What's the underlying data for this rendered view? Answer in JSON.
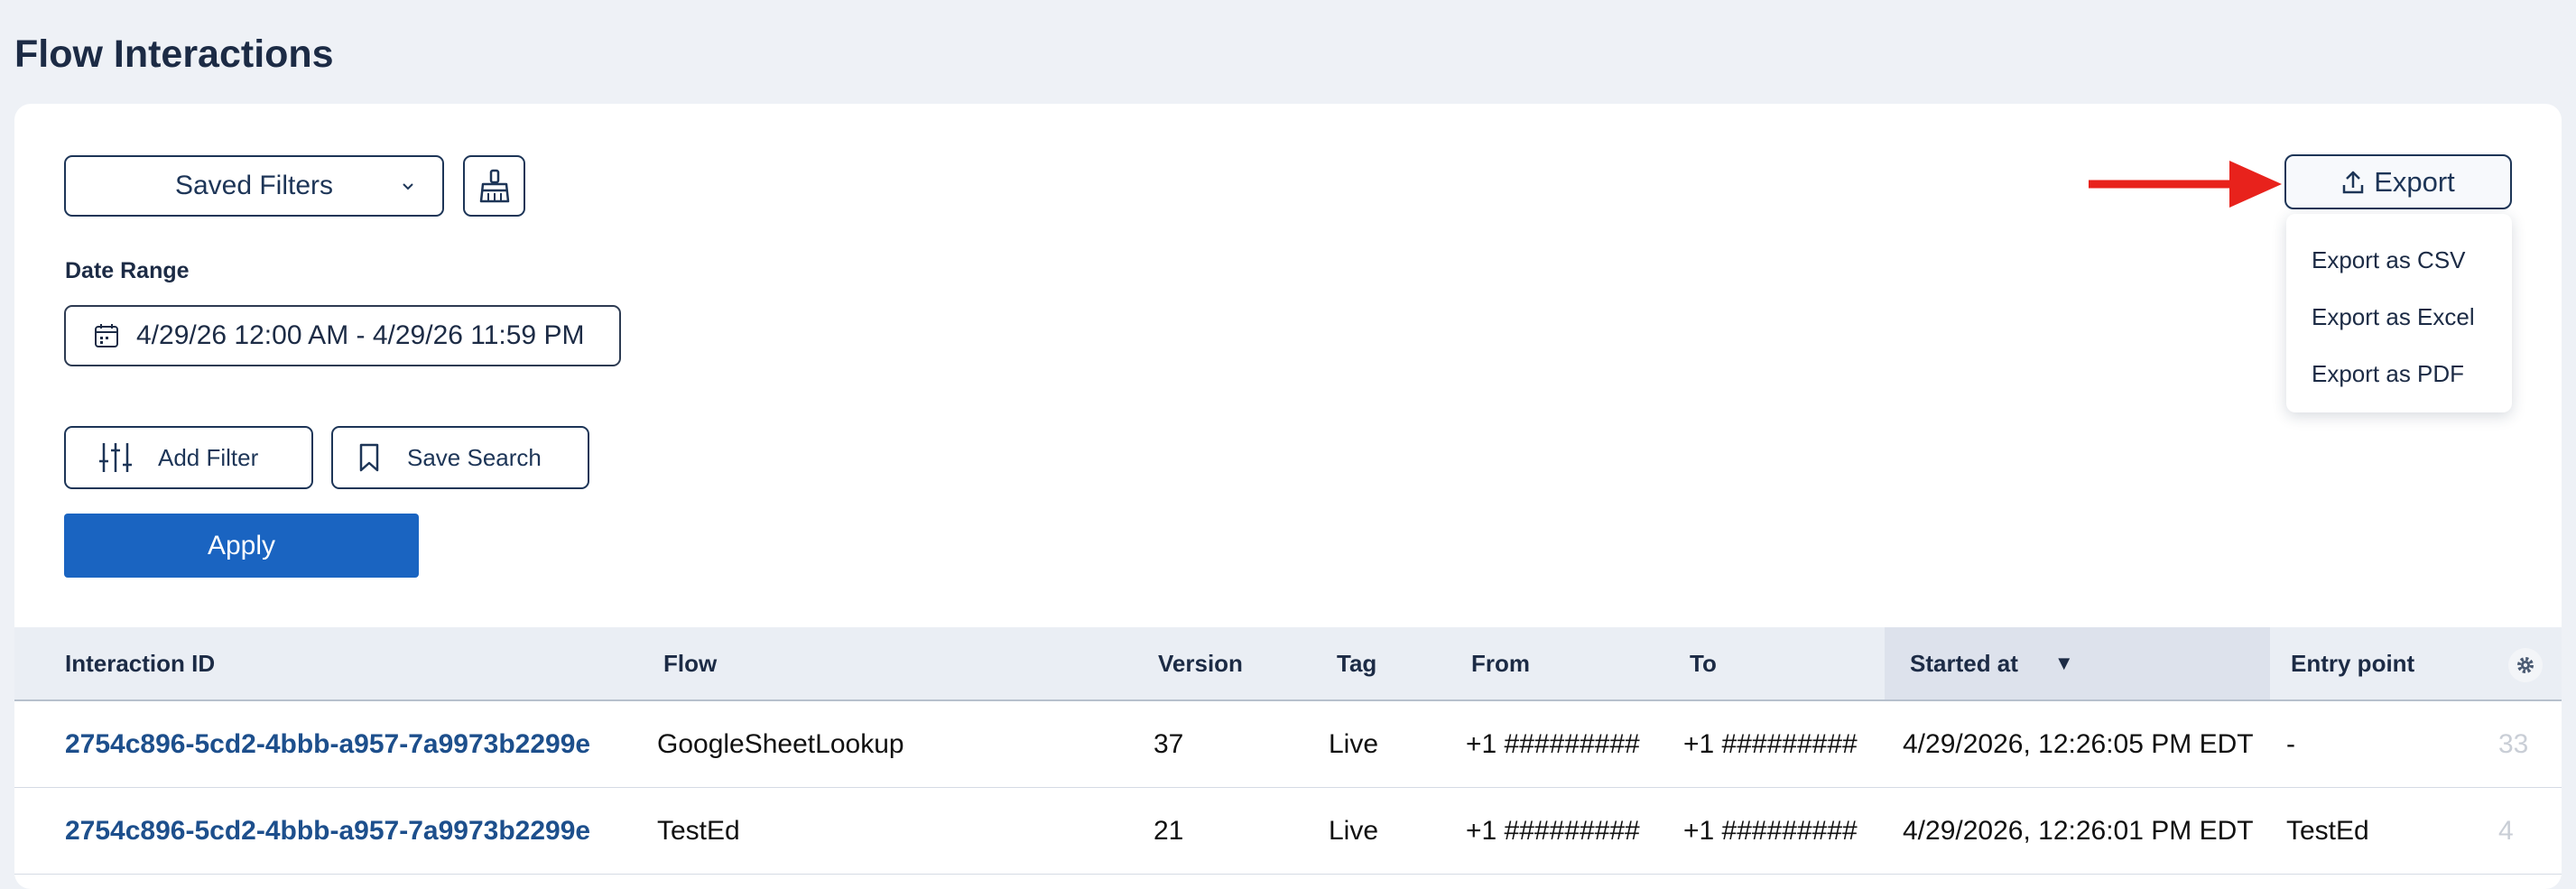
{
  "page": {
    "title": "Flow Interactions"
  },
  "filters": {
    "saved_filters_label": "Saved Filters",
    "date_range_label": "Date Range",
    "date_range_value": "4/29/26 12:00 AM - 4/29/26 11:59 PM",
    "add_filter_label": "Add Filter",
    "save_search_label": "Save Search",
    "apply_label": "Apply"
  },
  "export": {
    "button_label": "Export",
    "menu": [
      "Export as CSV",
      "Export as Excel",
      "Export as PDF"
    ]
  },
  "table": {
    "columns": [
      "Interaction ID",
      "Flow",
      "Version",
      "Tag",
      "From",
      "To",
      "Started at",
      "Entry point"
    ],
    "sort_indicator": "▼",
    "rows": [
      {
        "id": "2754c896-5cd2-4bbb-a957-7a9973b2299e",
        "flow": "GoogleSheetLookup",
        "version": "37",
        "tag": "Live",
        "from": "+1 #########",
        "to": "+1 #########",
        "started": "4/29/2026, 12:26:05 PM EDT",
        "entry": "-",
        "extra": "33"
      },
      {
        "id": "2754c896-5cd2-4bbb-a957-7a9973b2299e",
        "flow": "TestEd",
        "version": "21",
        "tag": "Live",
        "from": "+1 #########",
        "to": "+1 #########",
        "started": "4/29/2026, 12:26:01 PM EDT",
        "entry": "TestEd",
        "extra": "4"
      }
    ]
  },
  "icons": {
    "chevron": "chevron-down-icon",
    "clear": "broom-icon",
    "calendar": "calendar-icon",
    "sliders": "sliders-icon",
    "bookmark": "bookmark-icon",
    "upload": "upload-icon",
    "gear": "gear-icon",
    "arrow": "red-arrow-annotation"
  },
  "colors": {
    "primary": "#1a64c1",
    "navy": "#1d3557",
    "link": "#1d4f8c",
    "annotation": "#e8221c"
  }
}
